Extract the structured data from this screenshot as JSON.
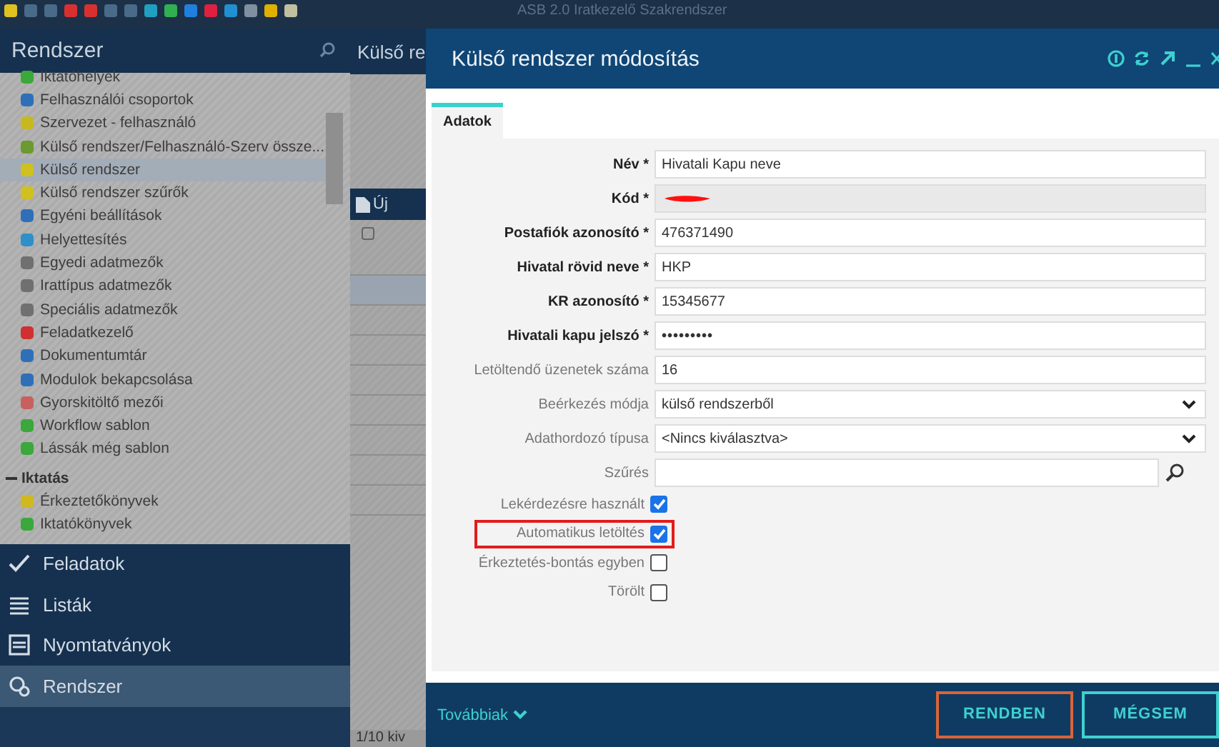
{
  "app": {
    "title": "ASB 2.0 Iratkezelő Szakrendszer",
    "toolbar_icons": [
      {
        "color": "#e0c020"
      },
      {
        "color": "#4a6a8a"
      },
      {
        "color": "#4a6a8a"
      },
      {
        "color": "#d83030"
      },
      {
        "color": "#d83030"
      },
      {
        "color": "#4a6a8a"
      },
      {
        "color": "#4a6a8a"
      },
      {
        "color": "#20a0c0"
      },
      {
        "color": "#30b050"
      },
      {
        "color": "#2080e0"
      },
      {
        "color": "#e02040"
      },
      {
        "color": "#2090d0"
      },
      {
        "color": "#8090a0"
      },
      {
        "color": "#e0b000"
      },
      {
        "color": "#c0c0a0"
      }
    ]
  },
  "sidebar": {
    "title": "Rendszer",
    "groups": [
      {
        "items": [
          {
            "label": "Iktatóhelyek",
            "color": "#3aa83a",
            "selected": false
          },
          {
            "label": "Felhasználói csoportok",
            "color": "#2f6fb8",
            "selected": false
          },
          {
            "label": "Szervezet - felhasználó",
            "color": "#c8b820",
            "selected": false
          },
          {
            "label": "Külső rendszer/Felhasználó-Szerv össze...",
            "color": "#6a9a30",
            "selected": false
          },
          {
            "label": "Külső rendszer",
            "color": "#d0c020",
            "selected": true
          },
          {
            "label": "Külső rendszer szűrők",
            "color": "#d0c020",
            "selected": false
          },
          {
            "label": "Egyéni beállítások",
            "color": "#2f6fb8",
            "selected": false
          },
          {
            "label": "Helyettesítés",
            "color": "#2f8fc8",
            "selected": false
          },
          {
            "label": "Egyedi adatmezők",
            "color": "#707070",
            "selected": false
          },
          {
            "label": "Irattípus adatmezők",
            "color": "#707070",
            "selected": false
          },
          {
            "label": "Speciális adatmezők",
            "color": "#707070",
            "selected": false
          },
          {
            "label": "Feladatkezelő",
            "color": "#d03030",
            "selected": false
          },
          {
            "label": "Dokumentumtár",
            "color": "#2f6fb8",
            "selected": false
          },
          {
            "label": "Modulok bekapcsolása",
            "color": "#2f6fb8",
            "selected": false
          },
          {
            "label": "Gyorskitöltő mezői",
            "color": "#c86060",
            "selected": false
          },
          {
            "label": "Workflow sablon",
            "color": "#3aa83a",
            "selected": false
          },
          {
            "label": "Lássák még sablon",
            "color": "#3aa83a",
            "selected": false
          }
        ]
      },
      {
        "label": "Iktatás",
        "expanded": true,
        "items": [
          {
            "label": "Érkeztetőkönyvek",
            "color": "#d0b820",
            "selected": false
          },
          {
            "label": "Iktatókönyvek",
            "color": "#3aa83a",
            "selected": false
          }
        ]
      }
    ],
    "nav": [
      {
        "label": "Feladatok",
        "kind": "check",
        "selected": false
      },
      {
        "label": "Listák",
        "kind": "list",
        "selected": false
      },
      {
        "label": "Nyomtatványok",
        "kind": "form",
        "selected": false
      },
      {
        "label": "Rendszer",
        "kind": "system",
        "selected": true
      }
    ]
  },
  "list_panel": {
    "title": "Külső re",
    "new_button": "Új",
    "select_all_checked": false,
    "footer": "1/10 kiv"
  },
  "dialog": {
    "title": "Külső rendszer módosítás",
    "tabs": [
      {
        "label": "Adatok",
        "selected": true
      }
    ],
    "fields": [
      {
        "label": "Név *",
        "kind": "text",
        "required": true,
        "value": "Hivatali Kapu neve"
      },
      {
        "label": "Kód *",
        "kind": "redacted",
        "required": true,
        "disabled": true
      },
      {
        "label": "Postafiók azonosító *",
        "kind": "text",
        "required": true,
        "value": "476371490"
      },
      {
        "label": "Hivatal rövid neve *",
        "kind": "text",
        "required": true,
        "value": "HKP"
      },
      {
        "label": "KR azonosító *",
        "kind": "text",
        "required": true,
        "value": "15345677"
      },
      {
        "label": "Hivatali kapu jelszó *",
        "kind": "password",
        "required": true,
        "value": "•••••••••"
      },
      {
        "label": "Letöltendő üzenetek száma",
        "kind": "text",
        "required": false,
        "value": "16"
      },
      {
        "label": "Beérkezés módja",
        "kind": "select",
        "required": false,
        "value": "külső rendszerből"
      },
      {
        "label": "Adathordozó típusa",
        "kind": "select",
        "required": false,
        "value": "<Nincs kiválasztva>"
      },
      {
        "label": "Szűrés",
        "kind": "search",
        "required": false
      },
      {
        "label": "Lekérdezésre használt",
        "kind": "checkbox",
        "required": false,
        "checked": true,
        "highlighted": false
      },
      {
        "label": "Automatikus letöltés",
        "kind": "checkbox",
        "required": false,
        "checked": true,
        "highlighted": true
      },
      {
        "label": "Érkeztetés-bontás egyben",
        "kind": "checkbox",
        "required": false,
        "checked": false,
        "highlighted": false
      },
      {
        "label": "Törölt",
        "kind": "checkbox",
        "required": false,
        "checked": false,
        "highlighted": false
      }
    ],
    "more_link": "Továbbiak",
    "buttons": [
      {
        "label": "RENDBEN",
        "highlighted": true
      },
      {
        "label": "MÉGSEM",
        "highlighted": false
      }
    ]
  }
}
